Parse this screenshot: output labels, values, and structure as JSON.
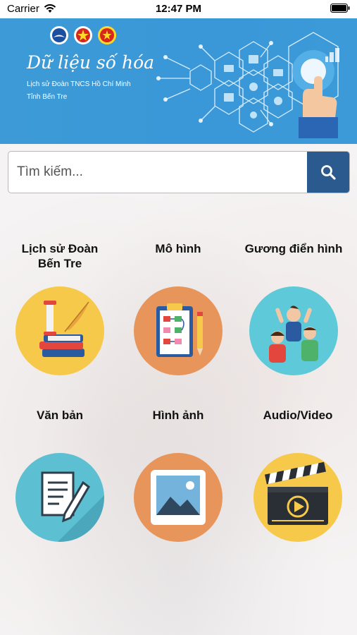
{
  "status_bar": {
    "carrier": "Carrier",
    "time": "12:47 PM"
  },
  "banner": {
    "title": "Dữ liệu số hóa",
    "subtitle_line1": "Lịch sử Đoàn TNCS Hồ Chí Minh",
    "subtitle_line2": "Tỉnh Bến Tre"
  },
  "search": {
    "placeholder": "Tìm kiếm..."
  },
  "tiles": [
    {
      "label": "Lịch sử Đoàn Bến Tre",
      "icon": "history-books-icon",
      "color": "#f7c94a"
    },
    {
      "label": "Mô hình",
      "icon": "clipboard-flowchart-icon",
      "color": "#e7955a"
    },
    {
      "label": "Gương điển hình",
      "icon": "people-cheering-icon",
      "color": "#5ec9d8"
    },
    {
      "label": "Văn bản",
      "icon": "document-pen-icon",
      "color": "#5cbfd2"
    },
    {
      "label": "Hình ảnh",
      "icon": "picture-icon",
      "color": "#e7955a"
    },
    {
      "label": "Audio/Video",
      "icon": "clapperboard-icon",
      "color": "#f7c94a"
    }
  ],
  "colors": {
    "banner": "#3a98d8",
    "search_button": "#2a5a8e"
  }
}
